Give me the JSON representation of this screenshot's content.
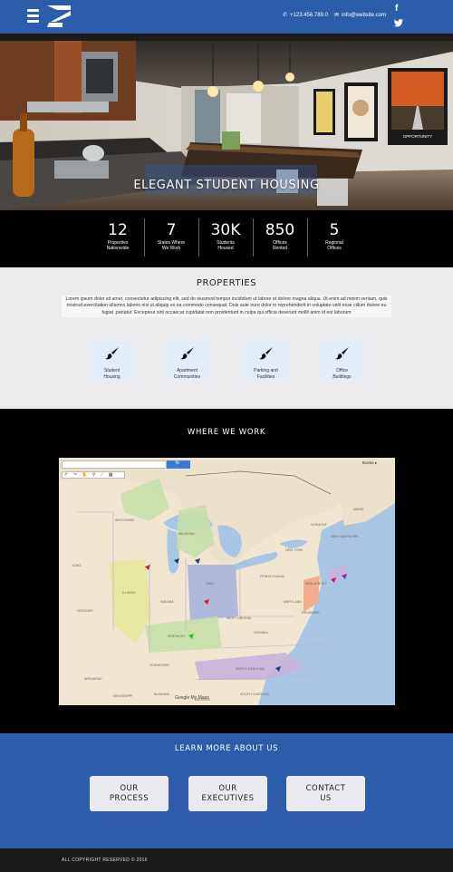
{
  "header": {
    "phone": "+123.456.789.0",
    "email": "info@website.com",
    "social": {
      "facebook": "f",
      "twitter": "t"
    }
  },
  "hero": {
    "title": "ELEGANT  STUDENT HOUSING",
    "artwork": [
      "PROPERTIES NATIONWIDE",
      "OPPORTUNITY"
    ]
  },
  "stats": [
    {
      "number": "12",
      "label": "Properties\nNationwide"
    },
    {
      "number": "7",
      "label": "States Where\nWe Work"
    },
    {
      "number": "30K",
      "label": "Students\nHoused"
    },
    {
      "number": "850",
      "label": "Offices\nRented"
    },
    {
      "number": "5",
      "label": "Regional\nOffices"
    }
  ],
  "properties": {
    "title": "PROPERTIES",
    "text": "Lorem ipsum dolor sit amet, consectetur adipiscing elit, sed do eiusmod tempor incididunt ut labore et dolore magna aliqua. Ut enim ad minim veniam, quis nostrud exercitation ullamco laboris nisi ut aliquip ex ea commodo consequat. Duis aute irure dolor in reprehenderit in voluptate velit esse cillum dolore eu fugiat .pariatur. Excepteur sint occaecat cupidatat non proidentunt in culpa qui officia deserunt mollit anim id est laborum",
    "cards": [
      {
        "label": "Student\nHousing",
        "icon": "paintbrush-icon"
      },
      {
        "label": "Apartment\nCommunities",
        "icon": "paintbrush-icon"
      },
      {
        "label": "Parking and\nFacilities",
        "icon": "paintbrush-icon"
      },
      {
        "label": "Office\nBuildings",
        "icon": "paintbrush-icon"
      }
    ]
  },
  "work": {
    "title": "WHERE WE WORK",
    "map": {
      "search_button": "🔍",
      "attribution": "Google My Maps",
      "credit": "Boeke ▸",
      "labels": [
        "WISCONSIN",
        "MICHIGAN",
        "IOWA",
        "ILLINOIS",
        "INDIANA",
        "OHIO",
        "PENNSYLVANIA",
        "NEW YORK",
        "NEW JERSEY",
        "KENTUCKY",
        "WEST VIRGINIA",
        "VIRGINIA",
        "TENNESSEE",
        "NORTH CAROLINA",
        "SOUTH CAROLINA",
        "MISSOURI",
        "ARKANSAS",
        "MISSISSIPPI",
        "ALABAMA",
        "GEORGIA",
        "MAINE",
        "VERMONT",
        "NEW HAMPSHIRE",
        "MARYLAND",
        "DELAWARE"
      ],
      "colors": {
        "water": "#a9c5e4",
        "land": "#f1e6d0",
        "highlight_green": "#c7dfa8",
        "highlight_yellow": "#e6e89e",
        "highlight_blue": "#a9b3dc",
        "highlight_orange": "#f3a98a",
        "highlight_purple": "#c8b3dc"
      }
    }
  },
  "learn": {
    "title": "LEARN MORE ABOUT US",
    "buttons": [
      "OUR\nPROCESS",
      "OUR\nEXECUTIVES",
      "CONTACT\nUS"
    ]
  },
  "footer": {
    "text": "ALL COPYRIGHT RESERVED © 2016"
  },
  "colors": {
    "brand_blue": "#2d5daa",
    "dark": "#000000",
    "light_gray": "#ececee",
    "card_blue": "#e3edf8"
  }
}
